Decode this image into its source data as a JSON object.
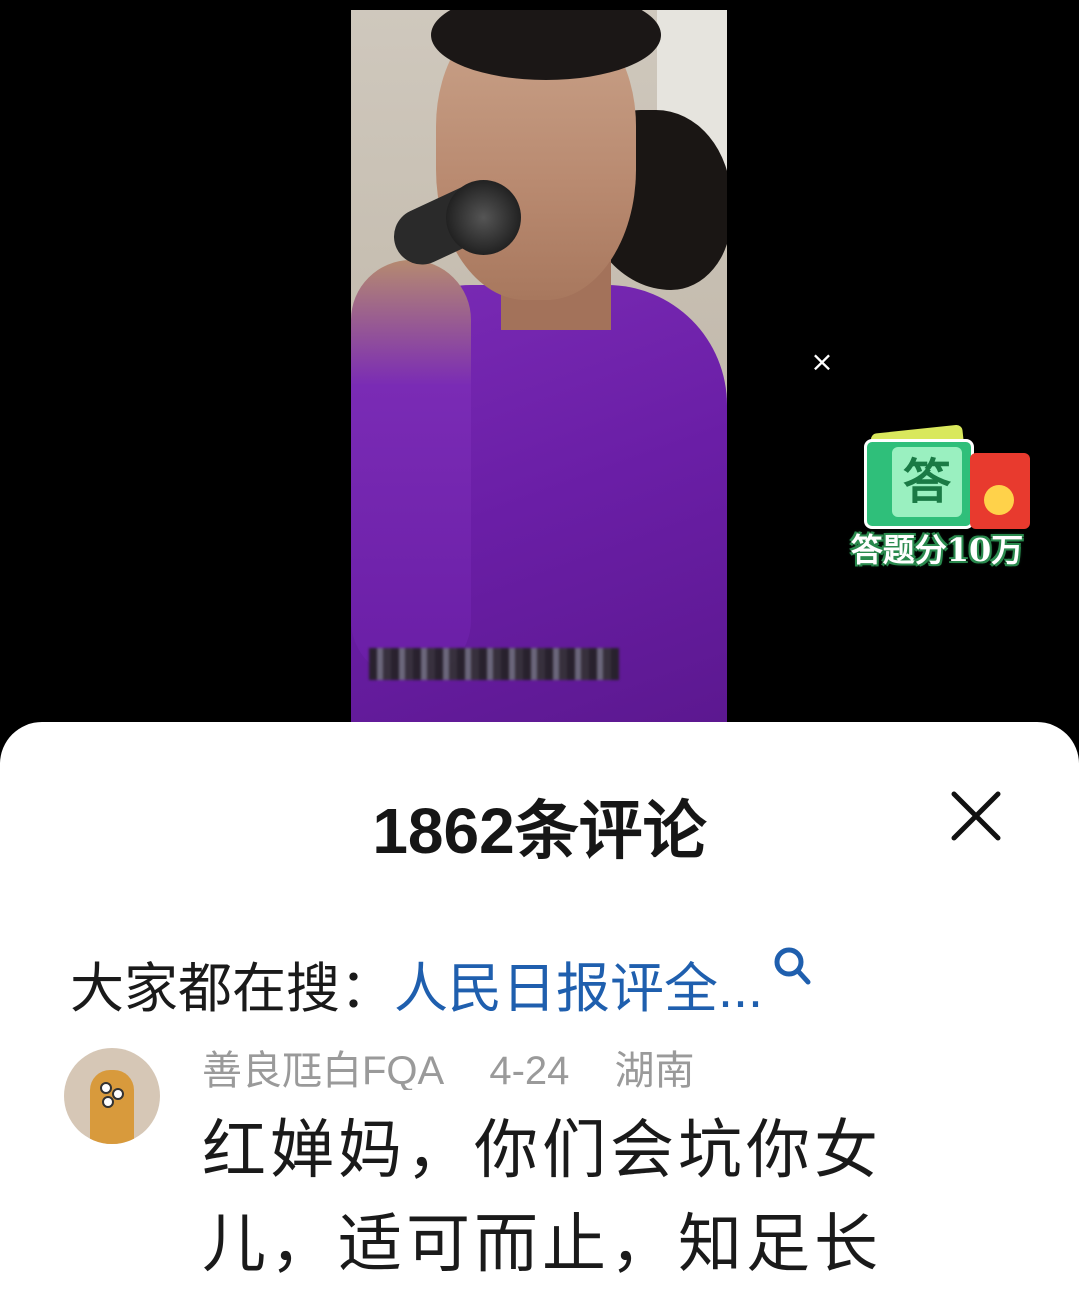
{
  "video": {
    "close_label": "×",
    "promo": {
      "icon_char": "答",
      "text": "答题分10万"
    }
  },
  "comments_sheet": {
    "title": "1862条评论",
    "search": {
      "label": "大家都在搜：",
      "query": "人民日报评全..."
    },
    "comments": [
      {
        "username": "善良尫白FQA",
        "date": "4-24",
        "location": "湖南",
        "text_lines": [
          "红婵妈，你们会坑你女",
          "儿，适可而止，知足长"
        ]
      }
    ]
  },
  "colors": {
    "link": "#1f5fae",
    "meta_text": "#9a9a9a",
    "sheet_bg": "#ffffff",
    "video_bg": "#000000",
    "shirt": "#6a1ea6"
  }
}
